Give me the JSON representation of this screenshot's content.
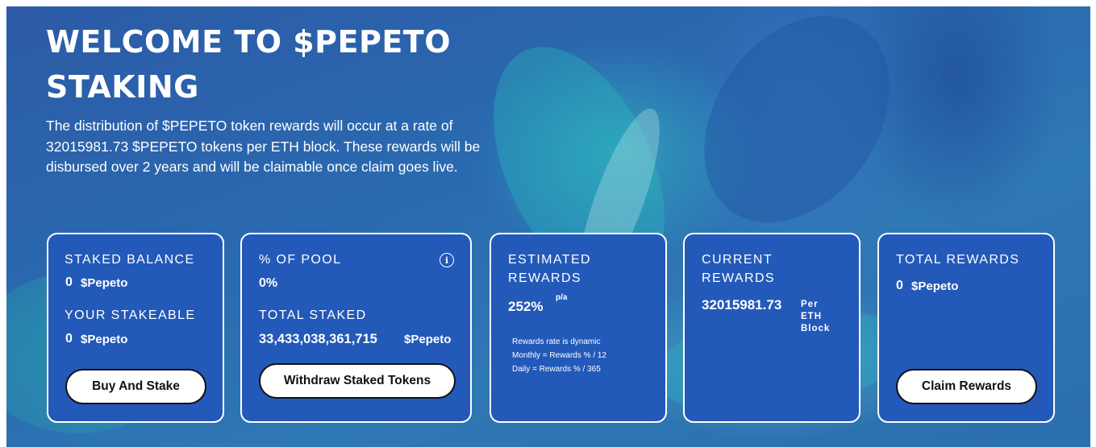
{
  "hero": {
    "title": "Welcome to $PEPETO Staking",
    "description": "The distribution of $PEPETO token rewards will occur at a rate of 32015981.73 $PEPETO tokens per ETH block. These rewards will be disbursed over 2 years and will be claimable once claim goes live."
  },
  "cards": {
    "staked_balance": {
      "label": "STAKED BALANCE",
      "value": "0",
      "unit": "$Pepeto",
      "stakeable_label": "YOUR STAKEABLE",
      "stakeable_value": "0",
      "stakeable_unit": "$Pepeto",
      "button": "Buy And Stake"
    },
    "pool": {
      "label": "% OF POOL",
      "info_icon": "info-icon",
      "value": "0%",
      "total_label": "TOTAL STAKED",
      "total_value": "33,433,038,361,715",
      "total_unit": "$Pepeto",
      "button": "Withdraw Staked Tokens"
    },
    "estimated": {
      "label_line1": "ESTIMATED",
      "label_line2": "REWARDS",
      "value": "252%",
      "suffix": "p/a",
      "notes": [
        "Rewards rate is dynamic",
        "Monthly = Rewards % / 12",
        "Daily = Rewards % / 365"
      ]
    },
    "current": {
      "label_line1": "CURRENT",
      "label_line2": "REWARDS",
      "value": "32015981.73",
      "per_lines": [
        "Per",
        "ETH",
        "Block"
      ]
    },
    "total": {
      "label": "TOTAL REWARDS",
      "value": "0",
      "unit": "$Pepeto",
      "button": "Claim Rewards"
    }
  },
  "colors": {
    "card_bg": "#2359b9",
    "card_border": "#ffffff",
    "button_bg": "#ffffff",
    "button_text": "#111111"
  }
}
